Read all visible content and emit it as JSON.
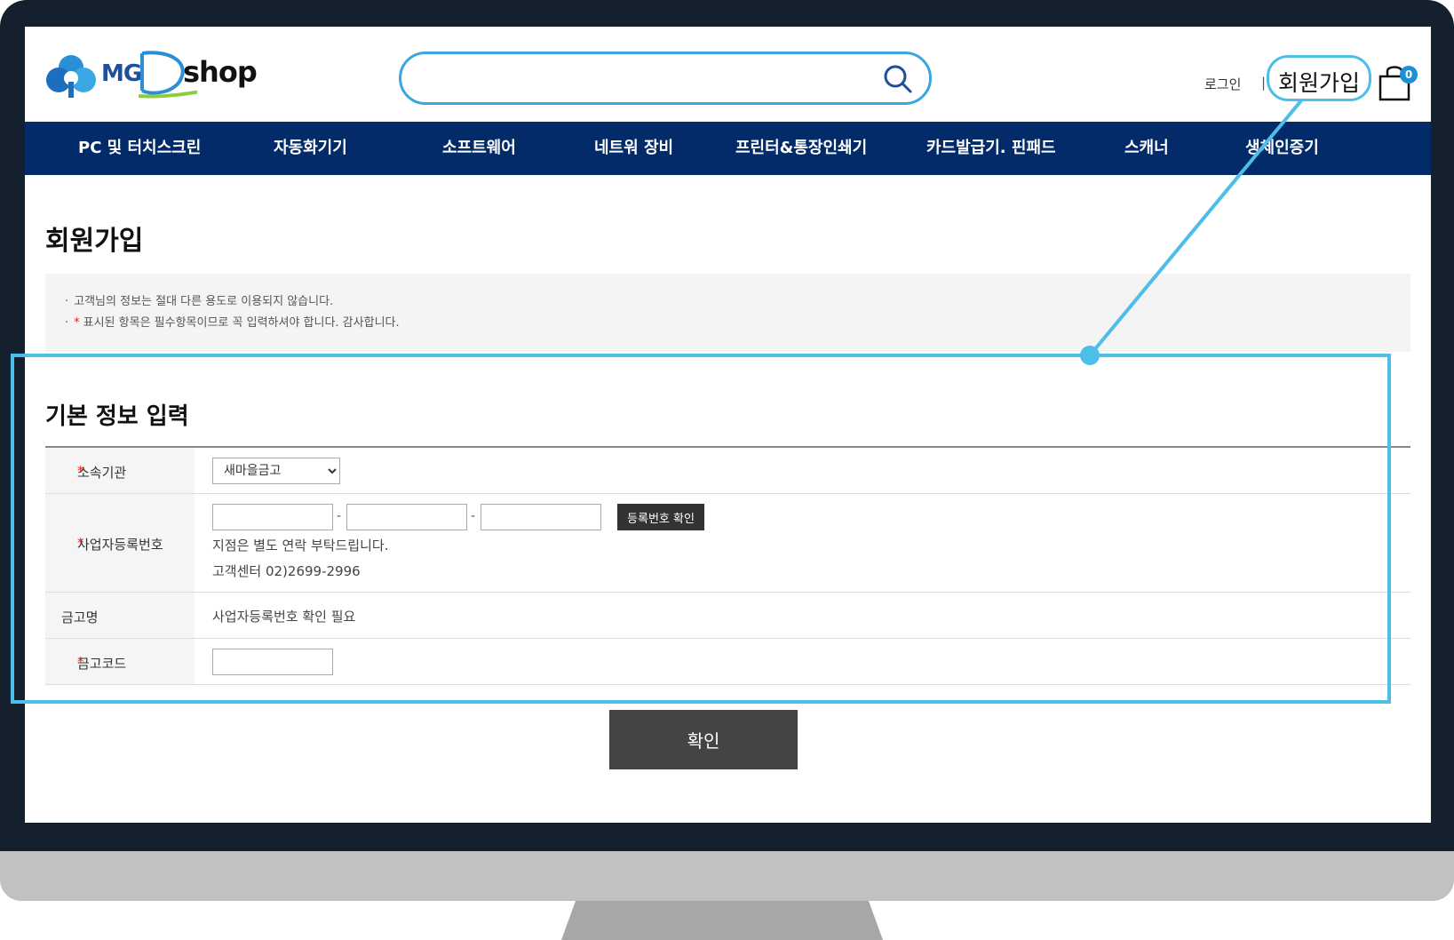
{
  "header": {
    "logo_mg": "MG",
    "logo_shop": "shop",
    "search_value": "",
    "login_label": "로그인",
    "separator": "|",
    "join_label": "회원가입",
    "cart_count": "0"
  },
  "nav": {
    "items": [
      "PC 및 터치스크린",
      "자동화기기",
      "소프트웨어",
      "네트워 장비",
      "프린터&통장인쇄기",
      "카드발급기. 핀패드",
      "스캐너",
      "생체인증기"
    ]
  },
  "page": {
    "title": "회원가입",
    "notice_1": "고객님의 정보는 절대 다른 용도로 이용되지 않습니다.",
    "notice_2_star": "*",
    "notice_2": "표시된 항목은 필수항목이므로 꼭 입력하셔야 합니다. 감사합니다.",
    "bullet": "·"
  },
  "form": {
    "section_title": "기본 정보 입력",
    "required_mark": "*",
    "org_label": "소속기관",
    "org_selected": "새마을금고",
    "biz_label": "사업자등록번호",
    "biz_dash": "-",
    "verify_button": "등록번호 확인",
    "biz_note_1": "지점은 별도 연락 부탁드립니다.",
    "biz_note_2": "고객센터 02)2699-2996",
    "bank_name_label": "금고명",
    "bank_name_value": "사업자등록번호 확인 필요",
    "bank_code_label": "금고코드"
  },
  "confirm_button": "확인",
  "colors": {
    "nav_bg": "#032b6a",
    "highlight": "#4dbde9",
    "search_border": "#39a6e0",
    "required": "#d22222",
    "button_dark": "#444444"
  }
}
